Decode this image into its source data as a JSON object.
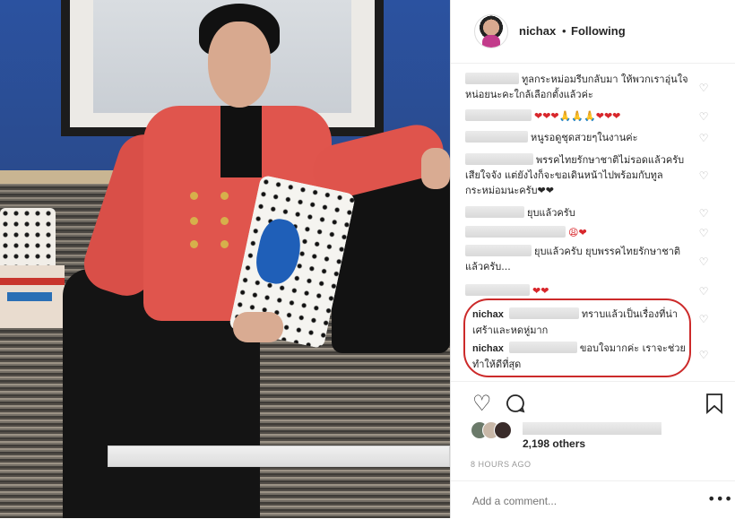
{
  "header": {
    "username": "nichax",
    "separator": "•",
    "follow_status": "Following"
  },
  "comments": [
    {
      "text": "ทูลกระหม่อมรีบกลับมา ให้พวกเราอุ่นใจหน่อยนะคะใกล้เลือกตั้งแล้วค่ะ"
    },
    {
      "text": "❤❤❤🙏🙏🙏❤❤❤"
    },
    {
      "text": "หนูรอดูชุดสวยๆในงานค่ะ"
    },
    {
      "text": "พรรคไทยรักษาชาติไม่รอดแล้วครับ เสียใจจัง แต่ยังไงก็จะขอเดินหน้าไปพร้อมกับทูลกระหม่อมนะครับ❤❤"
    },
    {
      "text": "ยุบแล้วครับ"
    },
    {
      "text": "😩❤"
    },
    {
      "text": "ยุบแล้วครับ ยุบพรรคไทยรักษาชาติแล้วครับ..."
    },
    {
      "text": "❤❤"
    }
  ],
  "replies": [
    {
      "username": "nichax",
      "text": "ทราบแล้วเป็นเรื่องที่น่าเศร้าและหดหู่มาก"
    },
    {
      "username": "nichax",
      "text": "ขอบใจมากค่ะ เราจะช่วยทำให้ดีที่สุด"
    }
  ],
  "likes": "2,198 others",
  "timestamp": "8 HOURS AGO",
  "add_comment": {
    "placeholder": "Add a comment..."
  },
  "icons": {
    "like": "heart-icon",
    "comment": "comment-icon",
    "save": "bookmark-icon",
    "more": "more-options-icon",
    "comment_like": "heart-icon"
  },
  "colors": {
    "highlight": "#cc2a2a",
    "heart_red": "#d8262b",
    "text": "#262626",
    "muted": "#999999"
  }
}
